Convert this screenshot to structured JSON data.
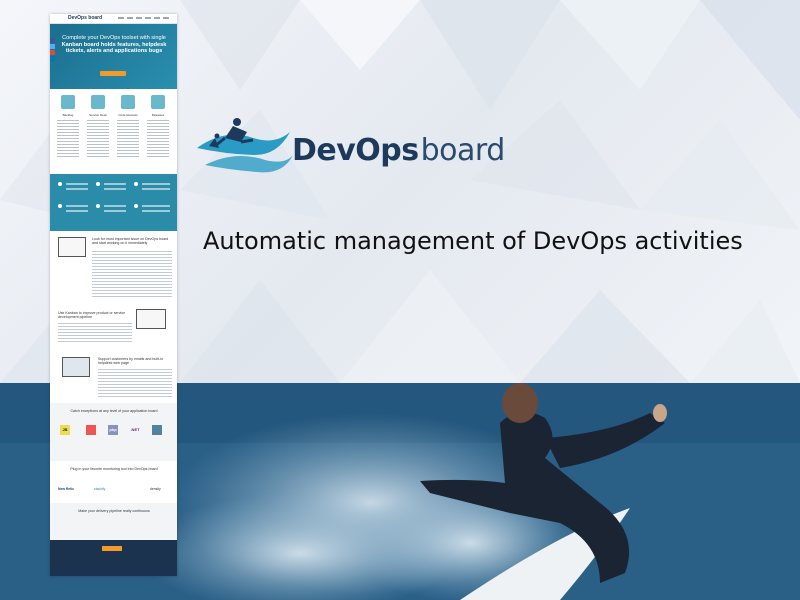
{
  "brand": {
    "name_part1": "DevOps",
    "name_part2": "board"
  },
  "tagline": "Automatic management of DevOps activities",
  "site_preview": {
    "nav_logo": "DevOps board",
    "hero_line1": "Complete your DevOps toolset with single",
    "hero_line2": "Kanban board holds features, helpdesk",
    "hero_line3": "tickets, alerts and applications bugs",
    "features": [
      "Backlog",
      "Service Desk",
      "Code Reviews",
      "Releases"
    ],
    "section1_heading": "Look for most important issue on DevOps board and start working on it immediately",
    "section2_heading": "Use Kanban to improve product or service development pipeline",
    "section3_heading": "Support customers by emails and built-in helpdesk web page",
    "section4_heading": "Catch exceptions at any level of your application board",
    "section5_heading": "Plug in your favorite monitoring tool into DevOps board",
    "section6_heading": "Make your delivery pipeline really continuous",
    "tech_logos": [
      "JS",
      "php",
      ".NET"
    ],
    "monitoring_logos": [
      "New Relic",
      "stackify",
      "density"
    ]
  },
  "colors": {
    "accent_teal": "#2a8ca8",
    "logo_navy": "#1d3a5c",
    "button_orange": "#f29b2c",
    "sea_blue": "#2d6a93"
  }
}
